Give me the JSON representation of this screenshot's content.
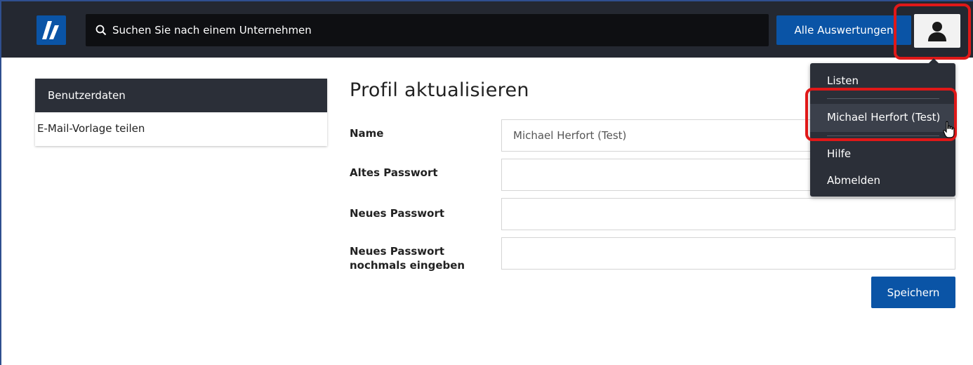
{
  "header": {
    "search_placeholder": "Suchen Sie nach einem Unternehmen",
    "all_reports_label": "Alle Auswertungen"
  },
  "sidebar": {
    "items": [
      {
        "label": "Benutzerdaten",
        "active": true
      },
      {
        "label": "E-Mail-Vorlage teilen",
        "active": false
      }
    ]
  },
  "form": {
    "title": "Profil aktualisieren",
    "fields": [
      {
        "label": "Name",
        "value": "Michael Herfort (Test)"
      },
      {
        "label": "Altes Passwort",
        "value": ""
      },
      {
        "label": "Neues Passwort",
        "value": ""
      },
      {
        "label": "Neues Passwort nochmals eingeben",
        "value": ""
      }
    ],
    "save_label": "Speichern"
  },
  "user_menu": {
    "items": [
      {
        "label": "Listen"
      },
      {
        "label": "Michael Herfort (Test)"
      },
      {
        "label": "Hilfe"
      },
      {
        "label": "Abmelden"
      }
    ]
  },
  "colors": {
    "topbar": "#242831",
    "brand_blue": "#0a54a6",
    "highlight_red": "#e01818",
    "dropdown_bg": "#2b2f38"
  }
}
